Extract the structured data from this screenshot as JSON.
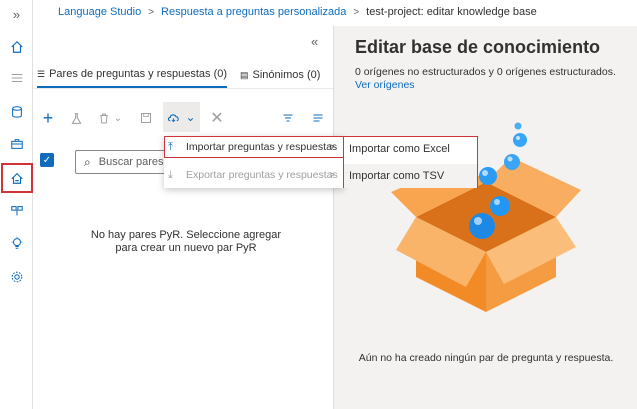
{
  "breadcrumb": {
    "items": [
      "Language Studio",
      "Respuesta a preguntas personalizada"
    ],
    "current": "test-project: editar knowledge base"
  },
  "rail": {
    "expand_icon": "double-chevron-right-icon",
    "items": [
      "home-icon",
      "list-icon",
      "database-icon",
      "briefcase-icon",
      "knowledge-base-icon",
      "deploy-icon",
      "lightbulb-icon",
      "settings-icon"
    ]
  },
  "left_panel": {
    "collapse_glyph": "«",
    "tabs": [
      {
        "label": "Pares de preguntas y respuestas (0)"
      },
      {
        "label": "Sinónimos (0)"
      }
    ],
    "search_placeholder": "Buscar pares",
    "empty_message": "No hay pares PyR. Seleccione agregar para crear un nuevo par PyR"
  },
  "import_menu": {
    "items": [
      {
        "label": "Importar preguntas y respuestas",
        "enabled": true
      },
      {
        "label": "Exportar preguntas y respuestas",
        "enabled": false
      }
    ],
    "submenu": [
      "Importar como Excel",
      "Importar como TSV"
    ]
  },
  "right_panel": {
    "title": "Editar base de conocimiento",
    "subtitle": "0 orígenes no estructurados y 0 orígenes estructurados.",
    "link": "Ver orígenes",
    "empty_message": "Aún no ha creado ningún par de pregunta y respuesta."
  },
  "colors": {
    "accent": "#0f6cbd",
    "highlight": "#d13438",
    "box": "#f7953b"
  }
}
